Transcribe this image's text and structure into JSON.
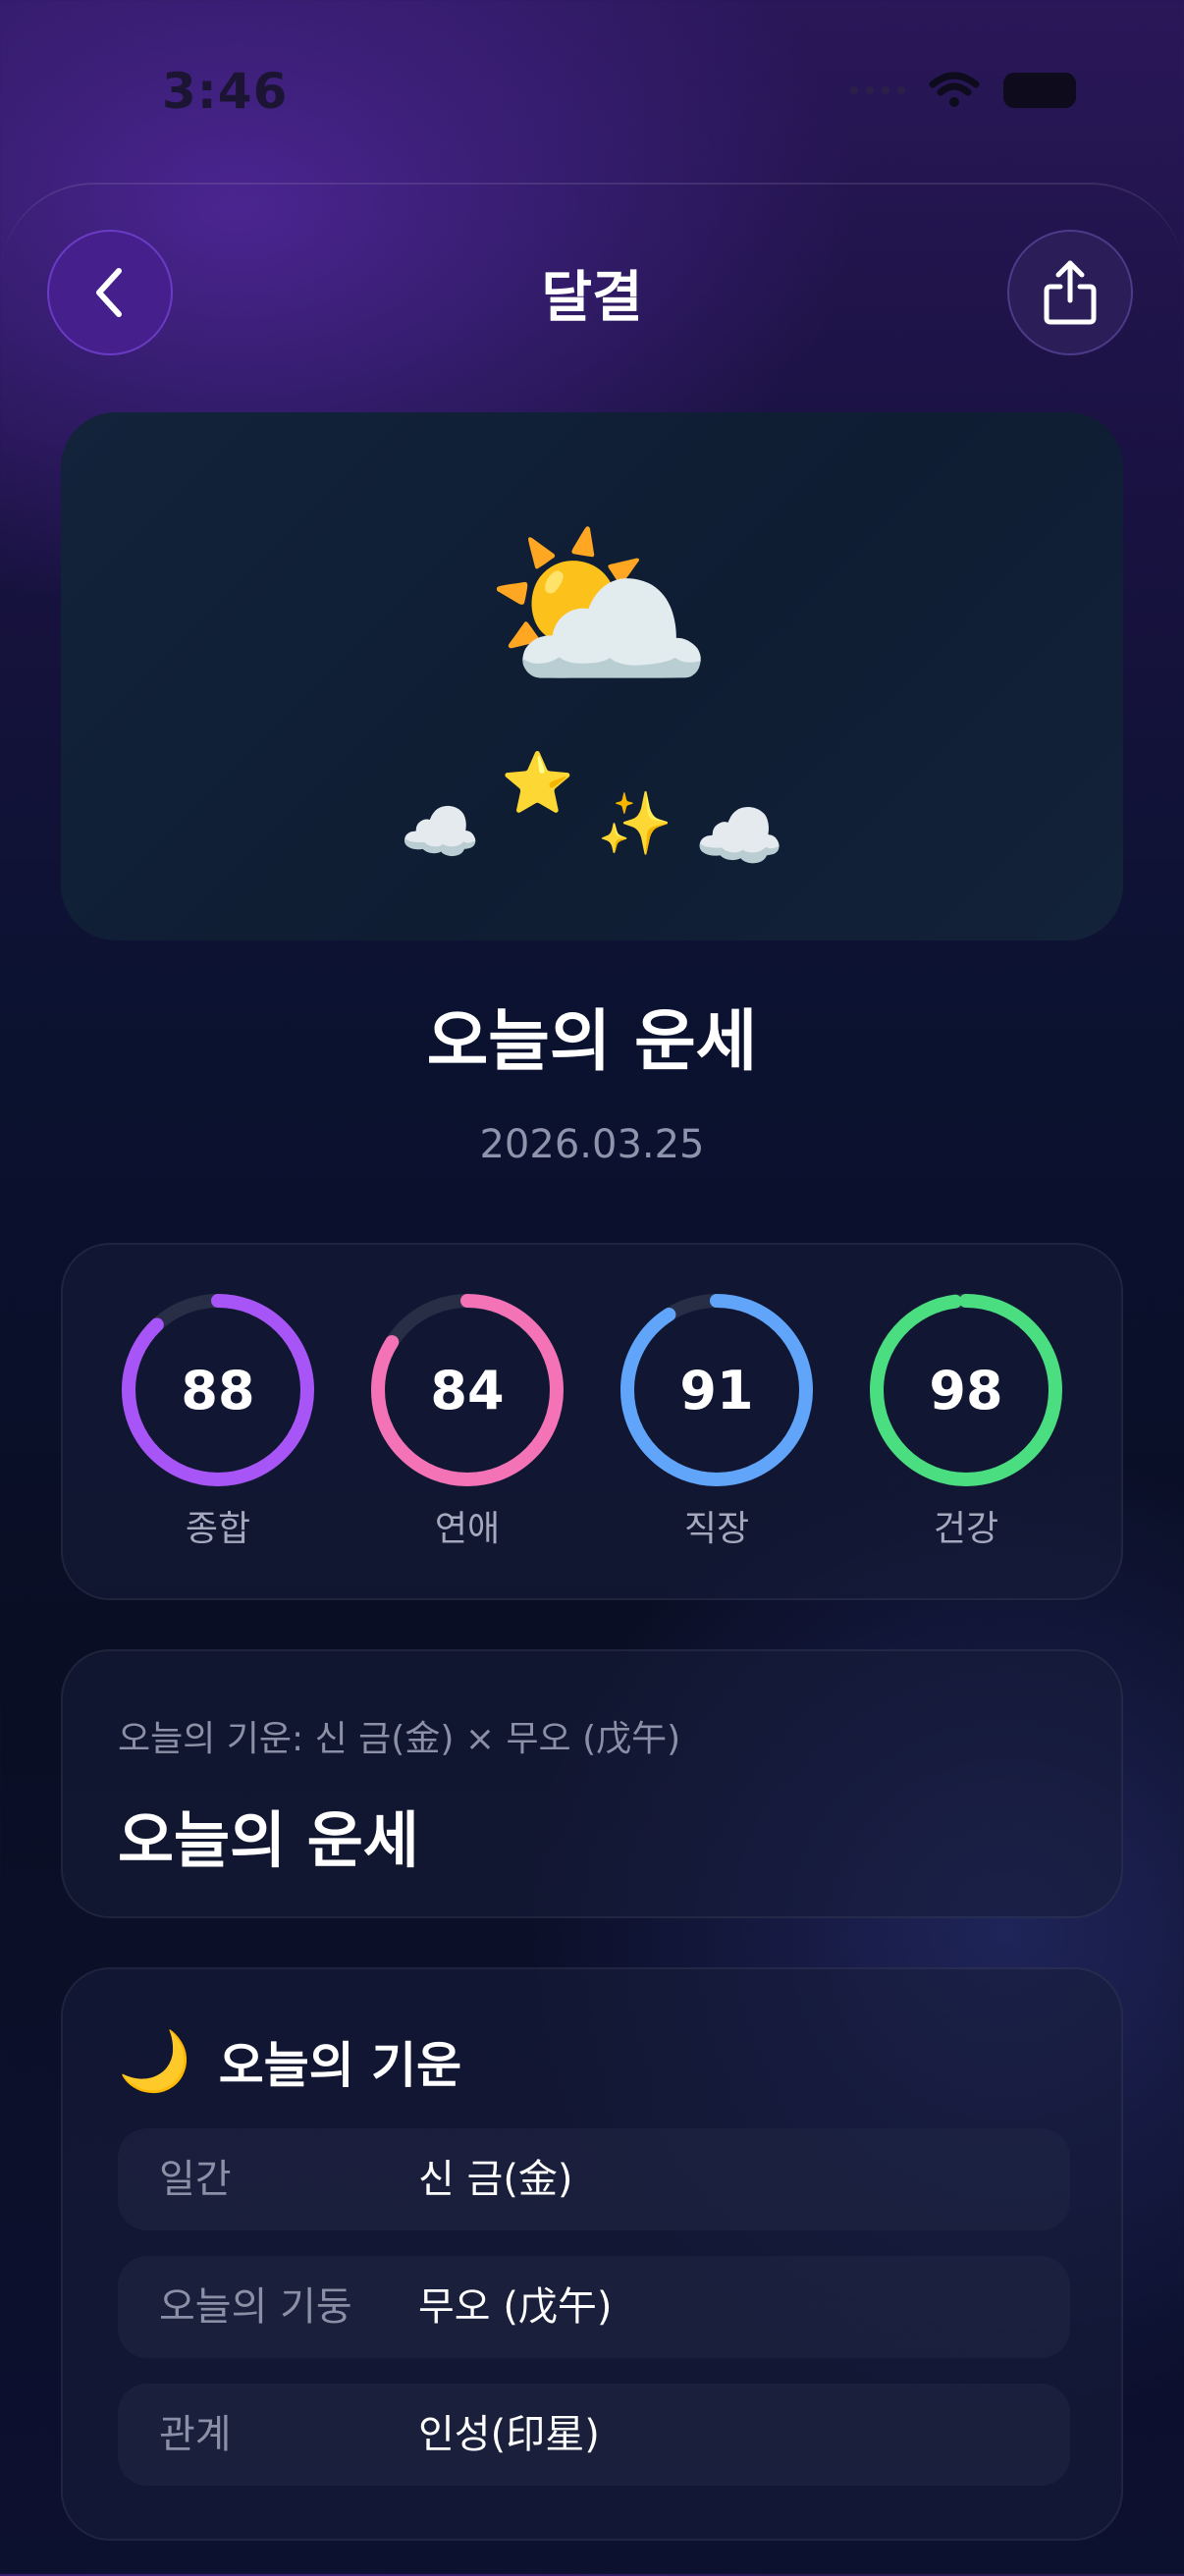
{
  "status_bar": {
    "time": "3:46"
  },
  "header": {
    "title": "달결",
    "back_icon": "chevron-left-icon",
    "share_icon": "share-icon"
  },
  "hero": {
    "main_emoji": "⛅",
    "decor": {
      "cloud": "☁️",
      "star": "⭐",
      "sparkles": "✨"
    }
  },
  "fortune": {
    "title": "오늘의 운세",
    "date": "2026.03.25"
  },
  "scores": [
    {
      "label": "종합",
      "value": "88",
      "pct": 0.88,
      "color": "#a855f7"
    },
    {
      "label": "연애",
      "value": "84",
      "pct": 0.84,
      "color": "#f472b6"
    },
    {
      "label": "직장",
      "value": "91",
      "pct": 0.91,
      "color": "#60a5fa"
    },
    {
      "label": "건강",
      "value": "98",
      "pct": 0.98,
      "color": "#4ade80"
    }
  ],
  "energy": {
    "subtitle": "오늘의 기운: 신 금(金) × 무오 (戊午)",
    "title": "오늘의 운세"
  },
  "details": {
    "icon": "🌙",
    "title": "오늘의 기운",
    "rows": [
      {
        "label": "일간",
        "value": "신 금(金)"
      },
      {
        "label": "오늘의 기둥",
        "value": "무오 (戊午)"
      },
      {
        "label": "관계",
        "value": "인성(印星)"
      }
    ]
  }
}
